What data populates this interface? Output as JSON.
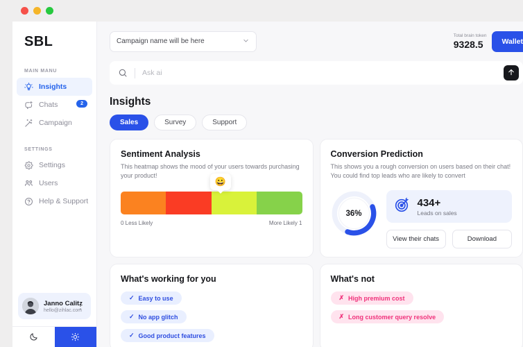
{
  "window": {
    "traffic_lights": [
      "close",
      "minimize",
      "zoom"
    ]
  },
  "sidebar": {
    "brand": "SBL",
    "sections": [
      {
        "title": "MAIN MANU",
        "items": [
          {
            "label": "Insights",
            "icon": "lightbulb-icon",
            "active": true,
            "badge": ""
          },
          {
            "label": "Chats",
            "icon": "chat-plus-icon",
            "active": false,
            "badge": "2"
          },
          {
            "label": "Campaign",
            "icon": "magic-wand-icon",
            "active": false,
            "badge": ""
          }
        ]
      },
      {
        "title": "SETTINGS",
        "items": [
          {
            "label": "Settings",
            "icon": "gear-icon",
            "active": false,
            "badge": ""
          },
          {
            "label": "Users",
            "icon": "users-icon",
            "active": false,
            "badge": ""
          },
          {
            "label": "Help & Support",
            "icon": "help-circle-icon",
            "active": false,
            "badge": ""
          }
        ]
      }
    ],
    "user": {
      "name": "Janno Calitz",
      "email": "hello@zihlac.com",
      "menu_icon": "kebab-menu-icon"
    },
    "theme": {
      "dark_icon": "moon-icon",
      "light_icon": "sun-icon",
      "selected": "light"
    }
  },
  "topbar": {
    "campaign_select": {
      "value": "Campaign name will be here",
      "chevron": "chevron-down-icon"
    },
    "token_label": "Total brain token",
    "token_value": "9328.5",
    "wallet_label": "Wallet"
  },
  "search": {
    "icon": "search-icon",
    "placeholder": "Ask ai",
    "value": "",
    "send_icon": "arrow-up-icon"
  },
  "page": {
    "title": "Insights",
    "tabs": [
      {
        "label": "Sales",
        "active": true
      },
      {
        "label": "Survey",
        "active": false
      },
      {
        "label": "Support",
        "active": false
      }
    ]
  },
  "cards": {
    "sentiment": {
      "title": "Sentiment Analysis",
      "subtitle": "This heatmap shows the mood of your users towards purchasing your product!",
      "emoji": "😀",
      "marker_position_pct": 55,
      "legend_left": "0 Less Likely",
      "legend_right": "More Likely 1",
      "segments": [
        "#fb8220",
        "#fa3c24",
        "#d9f23a",
        "#86d24a"
      ]
    },
    "conversion": {
      "title": "Conversion Prediction",
      "subtitle": "This shows you a rough conversion on users based on their chat! You could find top leads who are likely to convert",
      "percent_label": "36%",
      "percent_value": 36,
      "ring_color": "#2a51e8",
      "ring_track": "#e7ecfb",
      "leads_icon": "target-icon",
      "leads_value": "434+",
      "leads_caption": "Leads on sales",
      "buttons": [
        {
          "label": "View their chats"
        },
        {
          "label": "Download"
        }
      ]
    },
    "working": {
      "title": "What's working for you",
      "chips": [
        {
          "icon": "check-icon",
          "label": "Easy to use"
        },
        {
          "icon": "check-icon",
          "label": "No app glitch"
        },
        {
          "icon": "check-icon",
          "label": "Good product features"
        }
      ]
    },
    "not_working": {
      "title": "What's not",
      "chips": [
        {
          "icon": "cross-icon",
          "label": "High premium cost"
        },
        {
          "icon": "cross-icon",
          "label": "Long customer query resolve"
        }
      ]
    }
  },
  "colors": {
    "accent": "#2a51e8",
    "positive": "#2f4ee0",
    "negative": "#f0327b"
  }
}
